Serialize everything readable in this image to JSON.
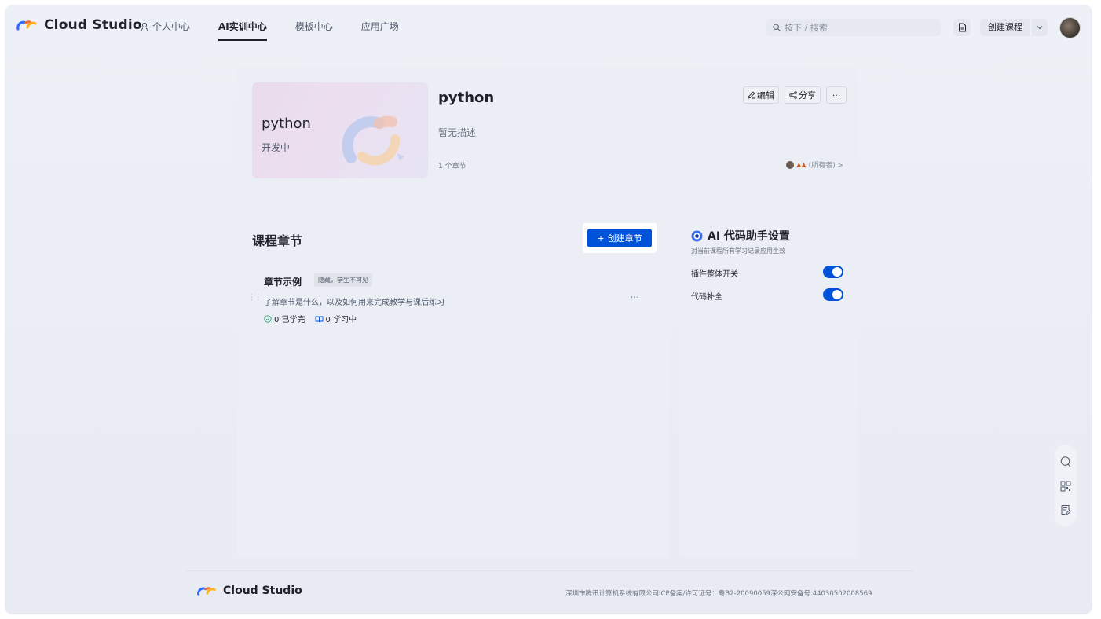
{
  "app": {
    "brand": "Cloud Studio"
  },
  "nav": {
    "items": [
      {
        "label": "个人中心",
        "icon": "user-icon",
        "active": false
      },
      {
        "label": "AI实训中心",
        "active": true
      },
      {
        "label": "模板中心",
        "active": false
      },
      {
        "label": "应用广场",
        "active": false
      }
    ]
  },
  "search": {
    "placeholder": "按下 / 搜索"
  },
  "toolbar": {
    "create_course": "创建课程"
  },
  "course": {
    "cover_title": "python",
    "cover_status": "开发中",
    "title": "python",
    "description": "暂无描述",
    "chapter_count": "1 个章节",
    "edit": "编辑",
    "share": "分享",
    "more": "···",
    "owner": "(所有者) >"
  },
  "chapters": {
    "title": "课程章节",
    "create_label": "创建章节",
    "items": [
      {
        "name": "章节示例",
        "tag": "隐藏，学生不可见",
        "desc": "了解章节是什么，以及如何用来完成教学与课后练习",
        "completed": "0 已学完",
        "learning": "0 学习中",
        "more": "···"
      }
    ]
  },
  "ai": {
    "title": "AI 代码助手设置",
    "subtitle": "对当前课程所有学习记录应用生效",
    "rows": [
      {
        "label": "插件整体开关",
        "enabled": true
      },
      {
        "label": "代码补全",
        "enabled": true
      }
    ]
  },
  "footer": {
    "brand": "Cloud Studio",
    "icp": "深圳市腾讯计算机系统有限公司ICP备案/许可证号：粤B2-20090059深公网安备号 44030502008569"
  },
  "colors": {
    "primary": "#0052d9",
    "background": "#eceef5"
  }
}
